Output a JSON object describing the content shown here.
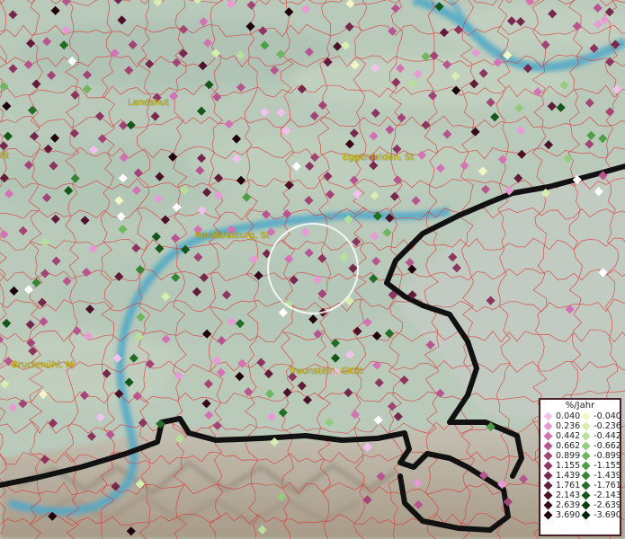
{
  "map": {
    "place_labels": [
      {
        "id": "landshut",
        "text": "Landshut"
      },
      {
        "id": "st-left",
        "text": "St"
      },
      {
        "id": "eggenfelden",
        "text": "Eggenfelden, St"
      },
      {
        "id": "waldkraiburg",
        "text": "Waldkraiburg, St"
      },
      {
        "id": "bruckmuehl",
        "text": "Bruckmühl, M"
      },
      {
        "id": "traunstein",
        "text": "Traunstein, GKSt"
      }
    ],
    "colors": {
      "terrain": "#b9cabb",
      "district_borders": "#e03030",
      "river": "#4fa8c8",
      "national_border": "#111111",
      "alps": "#b0a898"
    }
  },
  "legend": {
    "title": "%/Jahr",
    "positive": [
      {
        "label": "0.040",
        "color": "#f2c2ec"
      },
      {
        "label": "0.236",
        "color": "#e89ad6"
      },
      {
        "label": "0.442",
        "color": "#d472b4"
      },
      {
        "label": "0.662",
        "color": "#b85590"
      },
      {
        "label": "0.899",
        "color": "#a24475"
      },
      {
        "label": "1.155",
        "color": "#8c3560"
      },
      {
        "label": "1.439",
        "color": "#76284d"
      },
      {
        "label": "1.761",
        "color": "#611c3a"
      },
      {
        "label": "2.143",
        "color": "#4c122a"
      },
      {
        "label": "2.639",
        "color": "#360a1c"
      },
      {
        "label": "3.690",
        "color": "#1f030d"
      }
    ],
    "negative": [
      {
        "label": "-0.040",
        "color": "#f2f7c4"
      },
      {
        "label": "-0.236",
        "color": "#d8eeb0"
      },
      {
        "label": "-0.442",
        "color": "#b8e09a"
      },
      {
        "label": "-0.662",
        "color": "#92cc7c"
      },
      {
        "label": "-0.899",
        "color": "#6eb660"
      },
      {
        "label": "-1.155",
        "color": "#4e9e48"
      },
      {
        "label": "-1.439",
        "color": "#368636"
      },
      {
        "label": "-1.761",
        "color": "#226e26"
      },
      {
        "label": "-2.143",
        "color": "#15571a"
      },
      {
        "label": "-2.639",
        "color": "#0b3f10"
      },
      {
        "label": "-3.690",
        "color": "#032508"
      }
    ]
  }
}
